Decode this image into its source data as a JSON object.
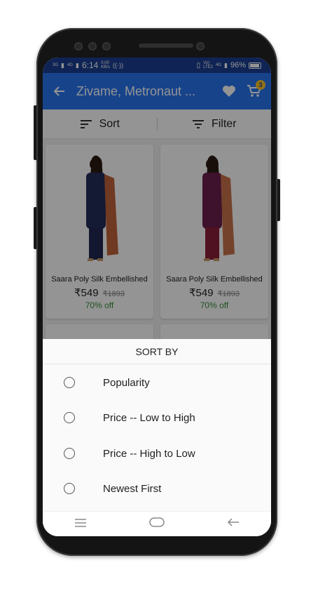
{
  "status_bar": {
    "network_left": "3G",
    "network_left2": "4G",
    "time": "6:14",
    "speed_value": "0.00",
    "speed_unit": "KB/s",
    "volte": "Vo)",
    "lte": "LTE2",
    "network_right": "4G",
    "battery": "96%",
    "battery_level": 0.96
  },
  "app_bar": {
    "title": "Zivame, Metronaut ...",
    "cart_count": "3"
  },
  "sort_filter": {
    "sort_label": "Sort",
    "filter_label": "Filter"
  },
  "products": [
    {
      "name": "Saara Poly Silk Embellished",
      "price": "₹549",
      "mrp": "₹1893",
      "discount": "70% off",
      "colors": {
        "top": "#232c5b",
        "bottom": "#1f2750",
        "dupatta": "#c1623a"
      }
    },
    {
      "name": "Saara Poly Silk Embellished",
      "price": "₹549",
      "mrp": "₹1893",
      "discount": "70% off",
      "colors": {
        "top": "#6c1e4f",
        "bottom": "#8b1f38",
        "dupatta": "#c9734a"
      }
    }
  ],
  "sort_sheet": {
    "title": "SORT BY",
    "options": [
      "Popularity",
      "Price -- Low to High",
      "Price -- High to Low",
      "Newest First"
    ]
  },
  "colors": {
    "app_bar": "#2874f0",
    "status_bar": "#1a3f93",
    "discount": "#388e3c",
    "cart_badge": "#f9c32b"
  },
  "icons": [
    "back-arrow-icon",
    "heart-icon",
    "cart-icon",
    "sort-icon",
    "filter-icon",
    "menu-icon",
    "home-icon",
    "back-nav-icon"
  ]
}
